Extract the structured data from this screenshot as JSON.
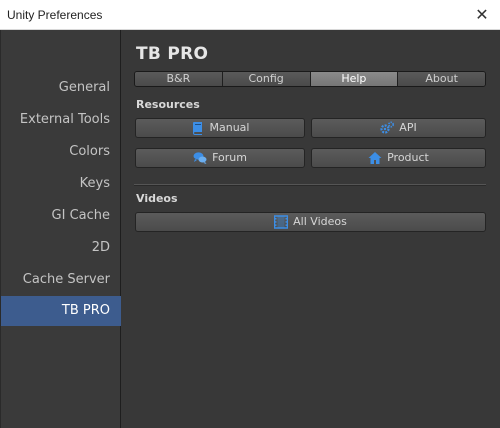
{
  "window": {
    "title": "Unity Preferences",
    "close_glyph": "✕"
  },
  "sidebar": {
    "items": [
      {
        "label": "General"
      },
      {
        "label": "External Tools"
      },
      {
        "label": "Colors"
      },
      {
        "label": "Keys"
      },
      {
        "label": "GI Cache"
      },
      {
        "label": "2D"
      },
      {
        "label": "Cache Server"
      },
      {
        "label": "TB PRO",
        "selected": true
      }
    ]
  },
  "main": {
    "title": "TB PRO",
    "tabs": [
      {
        "label": "B&R"
      },
      {
        "label": "Config"
      },
      {
        "label": "Help",
        "selected": true
      },
      {
        "label": "About"
      }
    ],
    "resources": {
      "heading": "Resources",
      "buttons": [
        {
          "label": "Manual",
          "icon": "book-icon"
        },
        {
          "label": "API",
          "icon": "gears-icon"
        },
        {
          "label": "Forum",
          "icon": "chat-icon"
        },
        {
          "label": "Product",
          "icon": "home-icon"
        }
      ]
    },
    "videos": {
      "heading": "Videos",
      "button": {
        "label": "All Videos",
        "icon": "film-icon"
      }
    }
  },
  "colors": {
    "accent_selected": "#3d5c8e",
    "icon_blue": "#3c8ee6",
    "panel_bg": "#383838"
  }
}
